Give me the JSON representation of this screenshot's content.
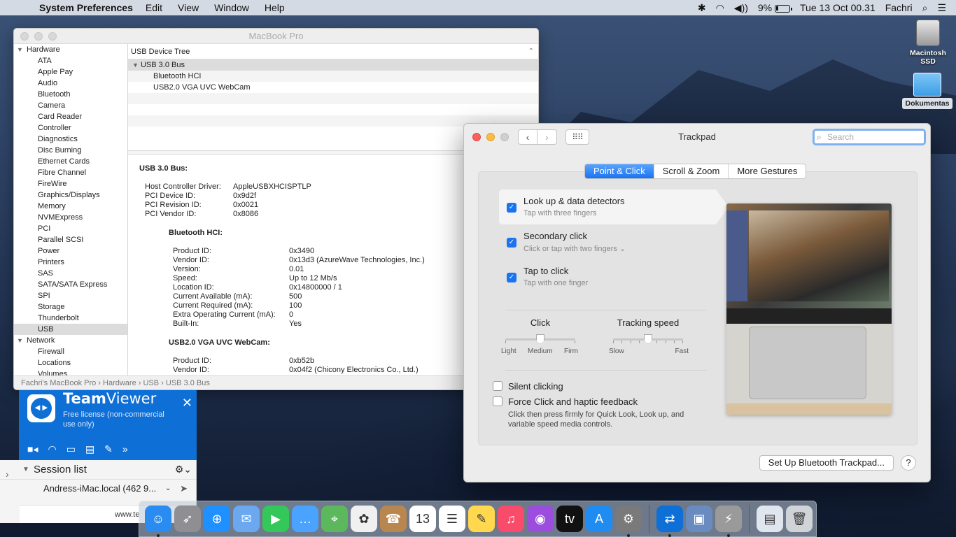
{
  "menubar": {
    "apple": "",
    "app_name": "System Preferences",
    "menus": [
      "Edit",
      "View",
      "Window",
      "Help"
    ],
    "bluetooth": "✱",
    "wifi": "◠",
    "volume": "◀))",
    "battery_percent": "9%",
    "datetime": "Tue 13 Oct  00.31",
    "user": "Fachri"
  },
  "desktop": {
    "icons": [
      {
        "label_line1": "Macintosh",
        "label_line2": "SSD"
      },
      {
        "label": "Dokumentas"
      }
    ]
  },
  "sysinfo": {
    "title": "MacBook Pro",
    "sidebar": {
      "hardware_label": "Hardware",
      "hardware_items": [
        "ATA",
        "Apple Pay",
        "Audio",
        "Bluetooth",
        "Camera",
        "Card Reader",
        "Controller",
        "Diagnostics",
        "Disc Burning",
        "Ethernet Cards",
        "Fibre Channel",
        "FireWire",
        "Graphics/Displays",
        "Memory",
        "NVMExpress",
        "PCI",
        "Parallel SCSI",
        "Power",
        "Printers",
        "SAS",
        "SATA/SATA Express",
        "SPI",
        "Storage",
        "Thunderbolt",
        "USB"
      ],
      "selected": "USB",
      "network_label": "Network",
      "network_items": [
        "Firewall",
        "Locations",
        "Volumes"
      ]
    },
    "tree": {
      "header": "USB Device Tree",
      "bus": "USB 3.0 Bus",
      "children": [
        "Bluetooth HCI",
        "USB2.0 VGA UVC WebCam"
      ]
    },
    "details": {
      "bus_heading": "USB 3.0 Bus:",
      "bus_props": [
        {
          "k": "Host Controller Driver:",
          "v": "AppleUSBXHCISPTLP"
        },
        {
          "k": "PCI Device ID:",
          "v": "0x9d2f"
        },
        {
          "k": "PCI Revision ID:",
          "v": "0x0021"
        },
        {
          "k": "PCI Vendor ID:",
          "v": "0x8086"
        }
      ],
      "bt_heading": "Bluetooth HCI:",
      "bt_props": [
        {
          "k": "Product ID:",
          "v": "0x3490"
        },
        {
          "k": "Vendor ID:",
          "v": "0x13d3  (AzureWave Technologies, Inc.)"
        },
        {
          "k": "Version:",
          "v": "0.01"
        },
        {
          "k": "Speed:",
          "v": "Up to 12 Mb/s"
        },
        {
          "k": "Location ID:",
          "v": "0x14800000 / 1"
        },
        {
          "k": "Current Available (mA):",
          "v": "500"
        },
        {
          "k": "Current Required (mA):",
          "v": "100"
        },
        {
          "k": "Extra Operating Current (mA):",
          "v": "0"
        },
        {
          "k": "Built-In:",
          "v": "Yes"
        }
      ],
      "cam_heading": "USB2.0 VGA UVC WebCam:",
      "cam_props": [
        {
          "k": "Product ID:",
          "v": "0xb52b"
        },
        {
          "k": "Vendor ID:",
          "v": "0x04f2  (Chicony Electronics Co., Ltd.)"
        }
      ]
    },
    "pathbar": "Fachri's MacBook Pro › Hardware › USB › USB 3.0 Bus"
  },
  "teamviewer": {
    "brand_bold": "Team",
    "brand_thin": "Viewer",
    "license": "Free license (non-commercial use only)",
    "close": "✕",
    "session_list_label": "Session list",
    "session_entry": "Andress-iMac.local (462 9...",
    "footer": "www.te"
  },
  "trackpad": {
    "title": "Trackpad",
    "search_placeholder": "Search",
    "tabs": [
      "Point & Click",
      "Scroll & Zoom",
      "More Gestures"
    ],
    "options": [
      {
        "title": "Look up & data detectors",
        "sub": "Tap with three fingers"
      },
      {
        "title": "Secondary click",
        "sub": "Click or tap with two fingers ⌄"
      },
      {
        "title": "Tap to click",
        "sub": "Tap with one finger"
      }
    ],
    "click": {
      "label": "Click",
      "min": "Light",
      "mid": "Medium",
      "max": "Firm",
      "level": 0.5
    },
    "tracking": {
      "label": "Tracking speed",
      "min": "Slow",
      "max": "Fast",
      "level": 0.5
    },
    "silent_clicking": "Silent clicking",
    "force_click": "Force Click and haptic feedback",
    "force_note": "Click then press firmly for Quick Look, Look up, and variable speed media controls.",
    "setup_button": "Set Up Bluetooth Trackpad...",
    "help_button": "?"
  },
  "dock": {
    "apps": [
      {
        "name": "finder",
        "color": "#2a8cf0",
        "glyph": "☺",
        "running": true
      },
      {
        "name": "launchpad",
        "color": "#8e8e93",
        "glyph": "➶",
        "running": false
      },
      {
        "name": "safari",
        "color": "#1e90ff",
        "glyph": "⊕",
        "running": false
      },
      {
        "name": "mail",
        "color": "#6ba8f0",
        "glyph": "✉",
        "running": false
      },
      {
        "name": "facetime",
        "color": "#34c759",
        "glyph": "▶",
        "running": false
      },
      {
        "name": "messages",
        "color": "#4aa3ff",
        "glyph": "…",
        "running": false
      },
      {
        "name": "maps",
        "color": "#5cb85c",
        "glyph": "⌖",
        "running": false
      },
      {
        "name": "photos",
        "color": "#f0f0f0",
        "glyph": "✿",
        "running": false
      },
      {
        "name": "contacts",
        "color": "#b8864e",
        "glyph": "☎",
        "running": false
      },
      {
        "name": "calendar",
        "color": "#ffffff",
        "glyph": "13",
        "running": false
      },
      {
        "name": "reminders",
        "color": "#ffffff",
        "glyph": "☰",
        "running": false
      },
      {
        "name": "notes",
        "color": "#ffd84d",
        "glyph": "✎",
        "running": false
      },
      {
        "name": "music",
        "color": "#f94c6b",
        "glyph": "♫",
        "running": false
      },
      {
        "name": "podcasts",
        "color": "#9b4dde",
        "glyph": "◉",
        "running": false
      },
      {
        "name": "tv",
        "color": "#111111",
        "glyph": "tv",
        "running": false
      },
      {
        "name": "app-store",
        "color": "#1e8cf0",
        "glyph": "A",
        "running": false
      },
      {
        "name": "system-preferences",
        "color": "#7a7a7a",
        "glyph": "⚙",
        "running": true
      },
      {
        "name": "teamviewer",
        "color": "#0e6fd6",
        "glyph": "⇄",
        "running": true
      },
      {
        "name": "preview",
        "color": "#6a8bbf",
        "glyph": "▣",
        "running": false
      },
      {
        "name": "system-information",
        "color": "#9a9a9a",
        "glyph": "⚡",
        "running": true
      },
      {
        "name": "screenshot-folder",
        "color": "#dfe6ee",
        "glyph": "▤",
        "running": false
      },
      {
        "name": "trash",
        "color": "#d0d4d8",
        "glyph": "🗑",
        "running": false
      }
    ]
  }
}
